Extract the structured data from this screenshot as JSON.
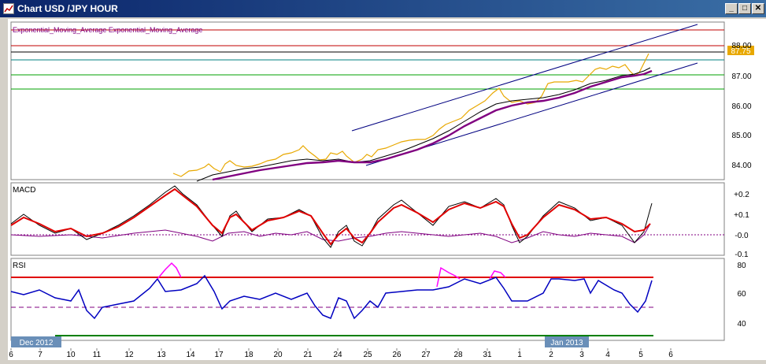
{
  "window": {
    "title": "Chart USD /JPY  HOUR",
    "minimize_label": "_",
    "maximize_label": "□",
    "close_label": "✕"
  },
  "colors": {
    "price": "#e8a800",
    "ema_fast": "#000000",
    "ema_slow": "#800080",
    "channel": "#000080",
    "macd_signal": "#e00000",
    "rsi_line": "#0000c0",
    "rsi_overbought": "#ff00ff",
    "hline_red": "#c00000",
    "hline_teal": "#008080",
    "hline_green": "#00a000",
    "current_price_badge": "#e8a800"
  },
  "price_panel": {
    "legend": "Exponential_Moving_Average  Exponential_Moving_Average",
    "current_price_label": "87.75",
    "axis_labels": [
      "88.00",
      "87.00",
      "86.00",
      "85.00",
      "84.00"
    ]
  },
  "macd_panel": {
    "label": "MACD",
    "axis_labels": [
      "+0.2",
      "+0.1",
      "-0.0",
      "-0.1"
    ]
  },
  "rsi_panel": {
    "label": "RSI",
    "axis_labels": [
      "80",
      "60",
      "40"
    ]
  },
  "month_tags": [
    "Dec 2012",
    "Jan 2013"
  ],
  "date_axis": [
    "6",
    "7",
    "10",
    "11",
    "12",
    "13",
    "14",
    "17",
    "18",
    "20",
    "21",
    "24",
    "25",
    "26",
    "27",
    "28",
    "31",
    "1",
    "2",
    "3",
    "4",
    "5",
    "6"
  ]
}
